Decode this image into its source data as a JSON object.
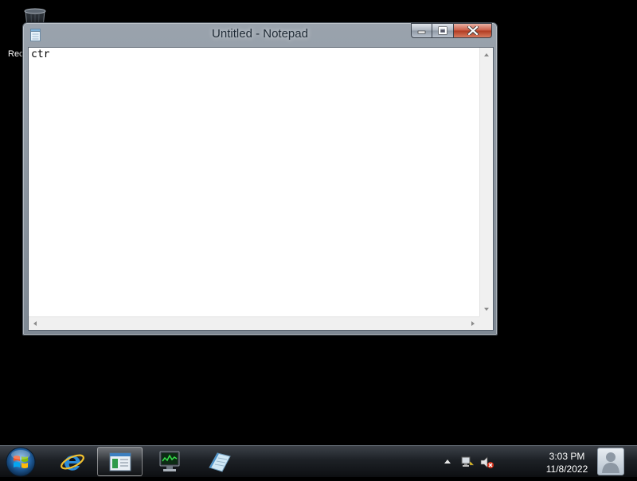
{
  "desktop": {
    "icons": [
      {
        "label": "Recy",
        "icon": "recycle-bin-icon"
      }
    ]
  },
  "notepad": {
    "title": "Untitled - Notepad",
    "content": "ctr",
    "icon": "notepad-icon",
    "buttons": {
      "minimize": "minimize-icon",
      "maximize": "maximize-icon",
      "close": "close-icon"
    }
  },
  "taskbar": {
    "start": "windows-logo-icon",
    "pinned": [
      {
        "name": "internet-explorer",
        "icon": "internet-explorer-icon"
      },
      {
        "name": "window-switcher",
        "icon": "window-icon",
        "active": true
      },
      {
        "name": "performance-monitor",
        "icon": "monitor-icon"
      },
      {
        "name": "notepad",
        "icon": "notepad-icon"
      }
    ],
    "tray": {
      "icons": [
        "show-hidden-icons-icon",
        "network-icon",
        "volume-muted-icon"
      ]
    },
    "clock": {
      "time": "3:03 PM",
      "date": "11/8/2022"
    }
  },
  "colors": {
    "desktop": "#000000",
    "close_button": "#c95a43",
    "taskbar": "#1d2126"
  }
}
